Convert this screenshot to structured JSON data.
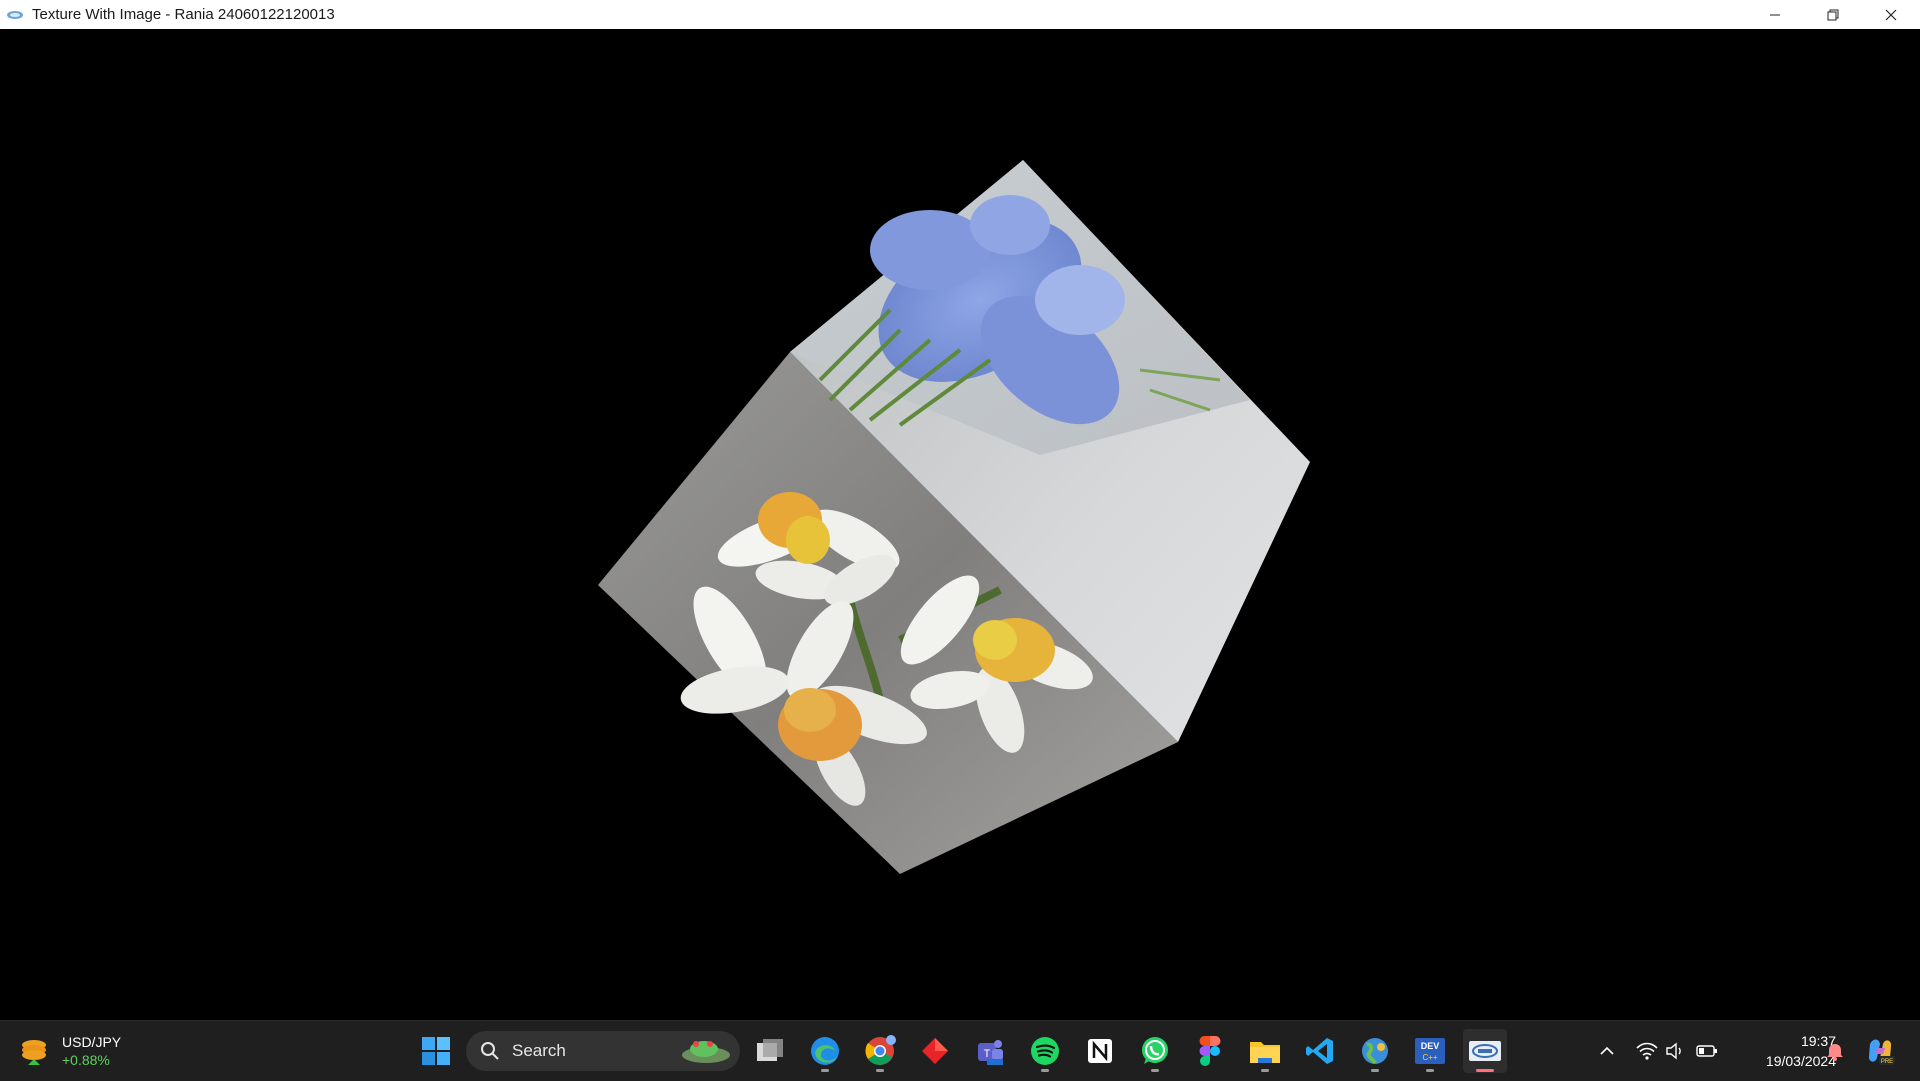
{
  "window": {
    "title": "Texture With Image - Rania 24060122120013",
    "controls": [
      "minimize",
      "restore",
      "close"
    ]
  },
  "scene": {
    "object": "textured cube",
    "faces": [
      "blue flowers photo",
      "white daffodils photo",
      "plain light-grey face"
    ],
    "background": "#000000"
  },
  "taskbar": {
    "widget": {
      "title": "USD/JPY",
      "change": "+0.88%",
      "change_color": "#5fd15f"
    },
    "search": {
      "label": "Search"
    },
    "apps": [
      {
        "name": "start-icon"
      },
      {
        "name": "task-view-icon"
      },
      {
        "name": "edge-icon"
      },
      {
        "name": "chrome-icon"
      },
      {
        "name": "gem-app-icon"
      },
      {
        "name": "teams-icon"
      },
      {
        "name": "spotify-icon"
      },
      {
        "name": "notion-icon"
      },
      {
        "name": "whatsapp-icon"
      },
      {
        "name": "figma-icon"
      },
      {
        "name": "file-explorer-icon"
      },
      {
        "name": "vscode-icon"
      },
      {
        "name": "globe-app-icon"
      },
      {
        "name": "dev-app-icon"
      },
      {
        "name": "opengl-window-icon"
      }
    ],
    "tray": {
      "clock_time": "19:37",
      "clock_date": "19/03/2024"
    }
  }
}
